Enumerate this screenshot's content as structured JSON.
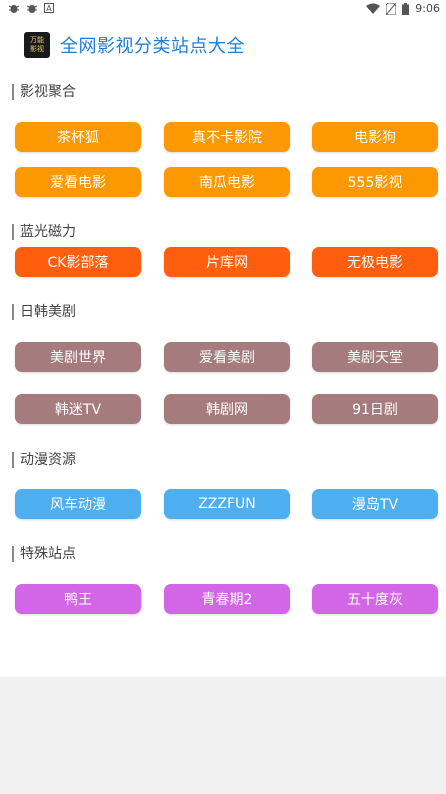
{
  "status_bar": {
    "time": "9:06",
    "left_icons": [
      "bug-icon",
      "bug-icon",
      "a-badge-icon"
    ],
    "right_icons": [
      "wifi-icon",
      "no-sim-icon",
      "battery-icon"
    ]
  },
  "app_bar": {
    "logo_line1": "万能",
    "logo_line2": "影视",
    "title": "全网影视分类站点大全"
  },
  "sections": [
    {
      "title": "影视聚合",
      "color": "#fc9802",
      "items": [
        "茶杯狐",
        "真不卡影院",
        "电影狗",
        "爱看电影",
        "南瓜电影",
        "555影视"
      ]
    },
    {
      "title": "蓝光磁力",
      "color": "#fe5e0d",
      "items": [
        "CK影部落",
        "片库网",
        "无极电影"
      ]
    },
    {
      "title": "日韩美剧",
      "color": "#a67b7d",
      "items": [
        "美剧世界",
        "爱看美剧",
        "美剧天堂",
        "韩迷TV",
        "韩剧网",
        "91日剧"
      ]
    },
    {
      "title": "动漫资源",
      "color": "#4dafef",
      "items": [
        "风车动漫",
        "ZZZFUN",
        "漫岛TV"
      ]
    },
    {
      "title": "特殊站点",
      "color": "#d266e6",
      "items": [
        "鸭王",
        "青春期2",
        "五十度灰"
      ]
    }
  ]
}
